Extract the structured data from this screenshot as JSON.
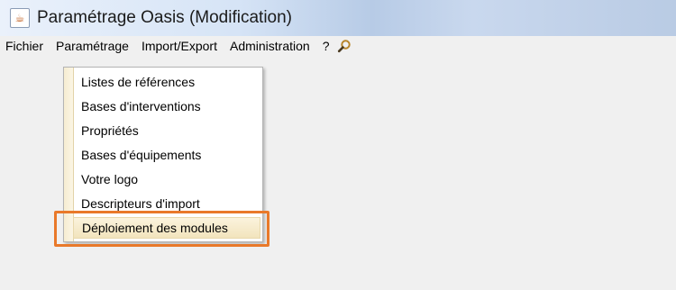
{
  "window": {
    "title": "Paramétrage Oasis (Modification)",
    "app_icon": "java-cup-icon"
  },
  "menubar": {
    "items": [
      "Fichier",
      "Paramétrage",
      "Import/Export",
      "Administration",
      "?"
    ],
    "search_icon": "search-icon"
  },
  "dropdown": {
    "open_menu": "Paramétrage",
    "items": [
      "Listes de références",
      "Bases d'interventions",
      "Propriétés",
      "Bases d'équipements",
      "Votre logo",
      "Descripteurs d'import",
      "Déploiement des modules"
    ],
    "highlighted_item": "Déploiement des modules"
  },
  "colors": {
    "callout_border": "#e9792a",
    "menu_gutter": "#f6edd2",
    "window_bg": "#f0f0f0"
  }
}
